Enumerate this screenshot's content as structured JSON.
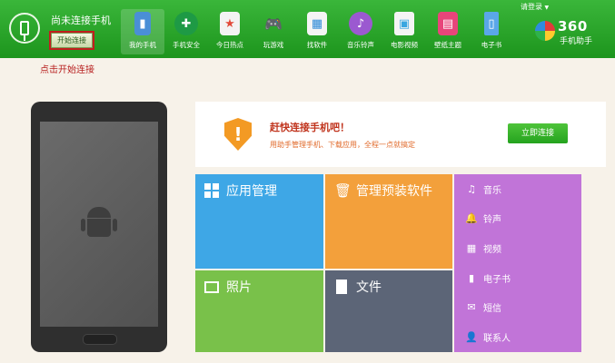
{
  "header": {
    "status": "尚未连接手机",
    "start_button": "开始连接",
    "login": "请登录",
    "logo_text": "360",
    "logo_sub": "手机助手",
    "nav": [
      {
        "label": "我的手机",
        "icon": "phone-icon",
        "color": "#4a8fd6"
      },
      {
        "label": "手机安全",
        "icon": "shield-icon",
        "color": "#2aa552"
      },
      {
        "label": "今日热点",
        "icon": "star-icon",
        "color": "#e24a3a"
      },
      {
        "label": "玩游戏",
        "icon": "gamepad-icon",
        "color": "#ffffff"
      },
      {
        "label": "找软件",
        "icon": "bag-icon",
        "color": "#2e8ad8"
      },
      {
        "label": "音乐铃声",
        "icon": "music-icon",
        "color": "#9b59d0"
      },
      {
        "label": "电影视频",
        "icon": "film-icon",
        "color": "#3aa6e0"
      },
      {
        "label": "壁纸主题",
        "icon": "wallpaper-icon",
        "color": "#e8457a"
      },
      {
        "label": "电子书",
        "icon": "book-icon",
        "color": "#5aa7e8"
      }
    ]
  },
  "hint": "点击开始连接",
  "banner": {
    "title": "赶快连接手机吧！",
    "subtitle": "用助手管理手机、下载应用，全程一点就搞定",
    "button": "立即连接"
  },
  "tiles": {
    "app": "应用管理",
    "preinstall": "管理预装软件",
    "photo": "照片",
    "file": "文件"
  },
  "sidebar": [
    {
      "label": "音乐",
      "icon": "music-note-icon"
    },
    {
      "label": "铃声",
      "icon": "bell-icon"
    },
    {
      "label": "视频",
      "icon": "video-icon"
    },
    {
      "label": "电子书",
      "icon": "ebook-icon"
    },
    {
      "label": "短信",
      "icon": "envelope-icon"
    },
    {
      "label": "联系人",
      "icon": "contact-icon"
    }
  ]
}
